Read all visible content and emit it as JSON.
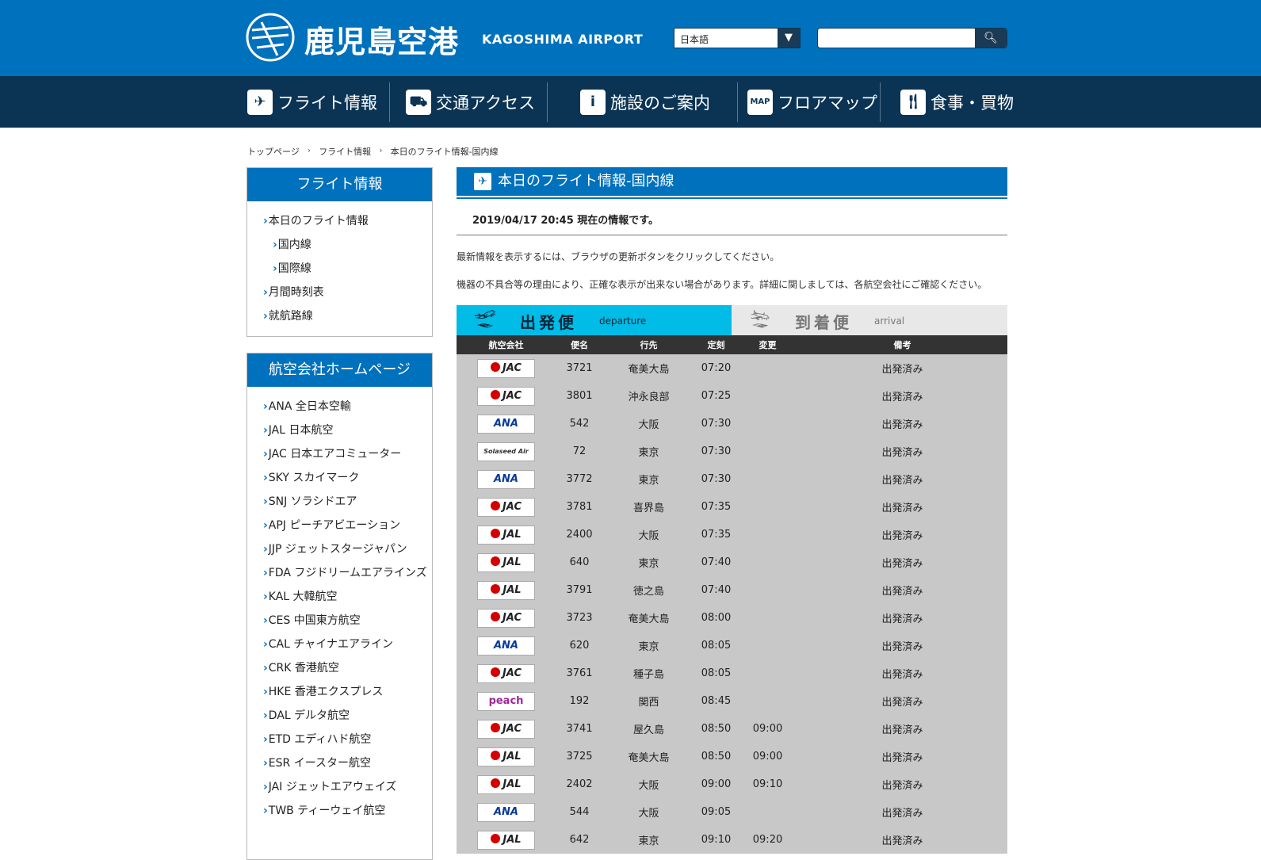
{
  "header": {
    "title": "鹿児島空港",
    "subtitle": "KAGOSHIMA AIRPORT",
    "lang_value": "日本語",
    "search_placeholder": ""
  },
  "nav": [
    {
      "label": "フライト情報",
      "icon": "plane-icon"
    },
    {
      "label": "交通アクセス",
      "icon": "car-icon"
    },
    {
      "label": "施設のご案内",
      "icon": "info-icon"
    },
    {
      "label": "フロアマップ",
      "icon": "map-icon"
    },
    {
      "label": "食事・買物",
      "icon": "dining-icon"
    }
  ],
  "breadcrumb": [
    "トップページ",
    "フライト情報",
    "本日のフライト情報-国内線"
  ],
  "sidebar1": {
    "title": "フライト情報",
    "items": [
      "本日のフライト情報",
      "国内線",
      "国際線",
      "月間時刻表",
      "就航路線"
    ]
  },
  "sidebar2": {
    "title": "航空会社ホームページ",
    "items": [
      "ANA 全日本空輸",
      "JAL 日本航空",
      "JAC 日本エアコミューター",
      "SKY スカイマーク",
      "SNJ ソラシドエア",
      "APJ ピーチアビエーション",
      "JJP ジェットスタージャパン",
      "FDA フジドリームエアラインズ",
      "KAL 大韓航空",
      "CES 中国東方航空",
      "CAL チャイナエアライン",
      "CRK 香港航空",
      "HKE 香港エクスプレス",
      "DAL デルタ航空",
      "ETD エディハド航空",
      "ESR イースター航空",
      "JAI ジェットエアウェイズ",
      "TWB ティーウェイ航空"
    ]
  },
  "main": {
    "title": "本日のフライト情報-国内線",
    "updated": "2019/04/17 20:45 現在の情報です。",
    "note1": "最新情報を表示するには、ブラウザの更新ボタンをクリックしてください。",
    "note2": "機器の不具合等の理由により、正確な表示が出来ない場合があります。詳細に関しましては、各航空会社にご確認ください。",
    "tab_departure": "出発便",
    "tab_departure_en": "departure",
    "tab_arrival": "到着便",
    "tab_arrival_en": "arrival",
    "columns": [
      "航空会社",
      "便名",
      "行先",
      "定刻",
      "変更",
      "備考"
    ]
  },
  "flights": [
    {
      "airline": "JAC",
      "flight": "3721",
      "dest": "奄美大島",
      "sched": "07:20",
      "change": "",
      "note": "出発済み"
    },
    {
      "airline": "JAC",
      "flight": "3801",
      "dest": "沖永良部",
      "sched": "07:25",
      "change": "",
      "note": "出発済み"
    },
    {
      "airline": "ANA",
      "flight": "542",
      "dest": "大阪",
      "sched": "07:30",
      "change": "",
      "note": "出発済み"
    },
    {
      "airline": "Solaseed Air",
      "flight": "72",
      "dest": "東京",
      "sched": "07:30",
      "change": "",
      "note": "出発済み"
    },
    {
      "airline": "ANA",
      "flight": "3772",
      "dest": "東京",
      "sched": "07:30",
      "change": "",
      "note": "出発済み"
    },
    {
      "airline": "JAC",
      "flight": "3781",
      "dest": "喜界島",
      "sched": "07:35",
      "change": "",
      "note": "出発済み"
    },
    {
      "airline": "JAL",
      "flight": "2400",
      "dest": "大阪",
      "sched": "07:35",
      "change": "",
      "note": "出発済み"
    },
    {
      "airline": "JAL",
      "flight": "640",
      "dest": "東京",
      "sched": "07:40",
      "change": "",
      "note": "出発済み"
    },
    {
      "airline": "JAL",
      "flight": "3791",
      "dest": "徳之島",
      "sched": "07:40",
      "change": "",
      "note": "出発済み"
    },
    {
      "airline": "JAC",
      "flight": "3723",
      "dest": "奄美大島",
      "sched": "08:00",
      "change": "",
      "note": "出発済み"
    },
    {
      "airline": "ANA",
      "flight": "620",
      "dest": "東京",
      "sched": "08:05",
      "change": "",
      "note": "出発済み"
    },
    {
      "airline": "JAC",
      "flight": "3761",
      "dest": "種子島",
      "sched": "08:05",
      "change": "",
      "note": "出発済み"
    },
    {
      "airline": "peach",
      "flight": "192",
      "dest": "関西",
      "sched": "08:45",
      "change": "",
      "note": "出発済み"
    },
    {
      "airline": "JAC",
      "flight": "3741",
      "dest": "屋久島",
      "sched": "08:50",
      "change": "09:00",
      "note": "出発済み"
    },
    {
      "airline": "JAL",
      "flight": "3725",
      "dest": "奄美大島",
      "sched": "08:50",
      "change": "09:00",
      "note": "出発済み"
    },
    {
      "airline": "JAL",
      "flight": "2402",
      "dest": "大阪",
      "sched": "09:00",
      "change": "09:10",
      "note": "出発済み"
    },
    {
      "airline": "ANA",
      "flight": "544",
      "dest": "大阪",
      "sched": "09:05",
      "change": "",
      "note": "出発済み"
    },
    {
      "airline": "JAL",
      "flight": "642",
      "dest": "東京",
      "sched": "09:10",
      "change": "09:20",
      "note": "出発済み"
    }
  ]
}
